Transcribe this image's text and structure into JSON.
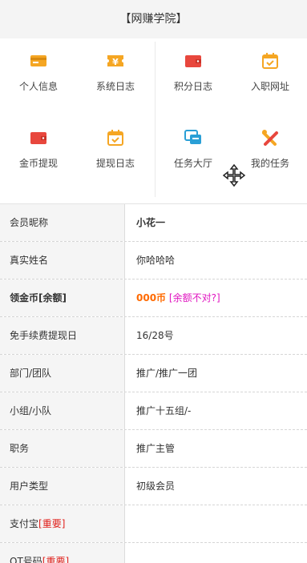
{
  "header": {
    "title": "【网赚学院】"
  },
  "menu": [
    {
      "label": "个人信息",
      "icon": "id-card-icon"
    },
    {
      "label": "系统日志",
      "icon": "yen-ticket-icon"
    },
    {
      "label": "积分日志",
      "icon": "wallet-icon"
    },
    {
      "label": "入职网址",
      "icon": "calendar-check-icon"
    },
    {
      "label": "金币提现",
      "icon": "wallet-icon"
    },
    {
      "label": "提现日志",
      "icon": "calendar-check-icon"
    },
    {
      "label": "任务大厅",
      "icon": "chat-message-icon"
    },
    {
      "label": "我的任务",
      "icon": "tools-icon"
    }
  ],
  "profile": {
    "rows": [
      {
        "key": "会员昵称",
        "value": "小花一"
      },
      {
        "key": "真实姓名",
        "value": "你哈哈哈"
      },
      {
        "key": "领金币[余额]",
        "value": "000币",
        "note": "[余额不对?]"
      },
      {
        "key": "免手续费提现日",
        "value": "16/28号"
      },
      {
        "key": "部门/团队",
        "value": "推广/推广一团"
      },
      {
        "key": "小组/小队",
        "value": "推广十五组/-"
      },
      {
        "key": "职务",
        "value": "推广主管"
      },
      {
        "key": "用户类型",
        "value": "初级会员"
      },
      {
        "key": "支付宝",
        "tag": "[重要]",
        "value": ""
      },
      {
        "key": "QT号码",
        "tag": "[重要]",
        "value": ""
      }
    ]
  },
  "colors": {
    "orange": "#ff6a00",
    "red": "#e0201b",
    "magenta": "#e015c0",
    "icon_orange": "#f5a623",
    "icon_red": "#e8473d",
    "icon_teal": "#2a9fd6"
  }
}
